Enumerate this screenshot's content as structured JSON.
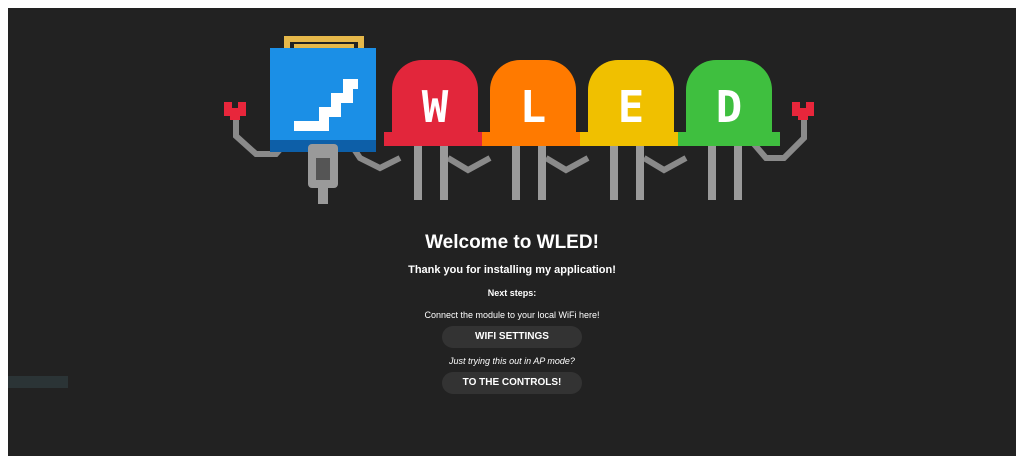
{
  "logo": {
    "letters": [
      "W",
      "L",
      "E",
      "D"
    ],
    "colors": {
      "chip": "#1b8fe6",
      "chip_dark": "#0d5fa8",
      "chip_top": "#e6b84a",
      "led_red": "#e2263b",
      "led_orange": "#ff7a00",
      "led_yellow": "#f0c000",
      "led_green": "#3fbf3f",
      "heart": "#e8263b",
      "wire": "#8a8a8a",
      "leg": "#9a9a9a"
    }
  },
  "welcome": {
    "title": "Welcome to WLED!",
    "subtitle": "Thank you for installing my application!",
    "next_steps": "Next steps:",
    "connect_text": "Connect the module to your local WiFi here!",
    "wifi_button": "WIFI SETTINGS",
    "ap_text": "Just trying this out in AP mode?",
    "controls_button": "TO THE CONTROLS!"
  }
}
